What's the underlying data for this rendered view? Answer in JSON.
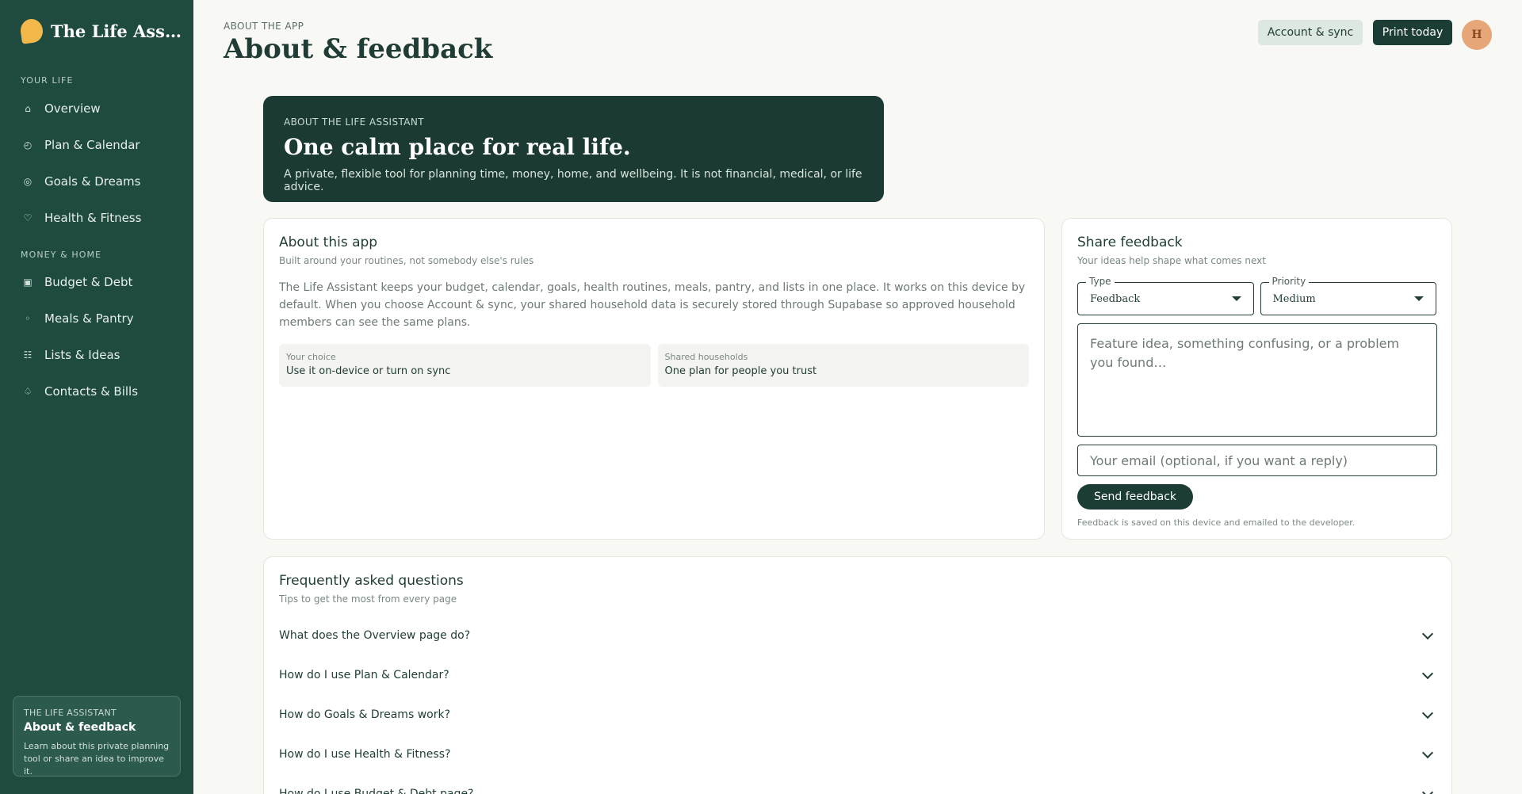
{
  "sidebar": {
    "brand": "The Life Assistant",
    "sections": [
      {
        "title": "YOUR LIFE",
        "items": [
          {
            "label": "Overview",
            "icon": "home-icon",
            "glyph": "⌂"
          },
          {
            "label": "Plan & Calendar",
            "icon": "clock-icon",
            "glyph": "◴"
          },
          {
            "label": "Goals & Dreams",
            "icon": "target-icon",
            "glyph": "◎"
          },
          {
            "label": "Health & Fitness",
            "icon": "heart-icon",
            "glyph": "♡"
          }
        ]
      },
      {
        "title": "MONEY & HOME",
        "items": [
          {
            "label": "Budget & Debt",
            "icon": "wallet-icon",
            "glyph": "▣"
          },
          {
            "label": "Meals & Pantry",
            "icon": "bowl-icon",
            "glyph": "◦"
          },
          {
            "label": "Lists & Ideas",
            "icon": "list-icon",
            "glyph": "☷"
          },
          {
            "label": "Contacts & Bills",
            "icon": "bell-icon",
            "glyph": "♤"
          }
        ]
      }
    ],
    "card": {
      "kicker": "THE LIFE ASSISTANT",
      "title": "About & feedback",
      "desc": "Learn about this private planning tool or share an idea to improve it."
    }
  },
  "header": {
    "crumb": "ABOUT THE APP",
    "title": "About & feedback",
    "sync_label": "Account & sync",
    "print_label": "Print today",
    "avatar_initial": "H"
  },
  "hero": {
    "kicker": "ABOUT THE LIFE ASSISTANT",
    "title": "One calm place for real life.",
    "desc": "A private, flexible tool for planning time, money, home, and wellbeing. It is not financial, medical, or life advice."
  },
  "about": {
    "title": "About this app",
    "subtitle": "Built around your routines, not somebody else's rules",
    "body": "The Life Assistant keeps your budget, calendar, goals, health routines, meals, pantry, and lists in one place. It works on this device by default. When you choose Account & sync, your shared household data is securely stored through Supabase so approved household members can see the same plans.",
    "choices": [
      {
        "label": "Your choice",
        "value": "Use it on-device or turn on sync"
      },
      {
        "label": "Shared households",
        "value": "One plan for people you trust"
      }
    ]
  },
  "feedback": {
    "title": "Share feedback",
    "subtitle": "Your ideas help shape what comes next",
    "type_label": "Type",
    "type_value": "Feedback",
    "priority_label": "Priority",
    "priority_value": "Medium",
    "message_placeholder": "Feature idea, something confusing, or a problem you found…",
    "email_placeholder": "Your email (optional, if you want a reply)",
    "send_label": "Send feedback",
    "note": "Feedback is saved on this device and emailed to the developer."
  },
  "faq": {
    "title": "Frequently asked questions",
    "subtitle": "Tips to get the most from every page",
    "items": [
      "What does the Overview page do?",
      "How do I use Plan & Calendar?",
      "How do Goals & Dreams work?",
      "How do I use Health & Fitness?",
      "How do I use Budget & Debt page?"
    ]
  },
  "colors": {
    "sidebar_bg": "#1f4a40",
    "accent_dark": "#1b3d35",
    "brand_logo": "#f2b84b",
    "avatar": "#e7a677",
    "page_bg": "#f8f8f4"
  }
}
